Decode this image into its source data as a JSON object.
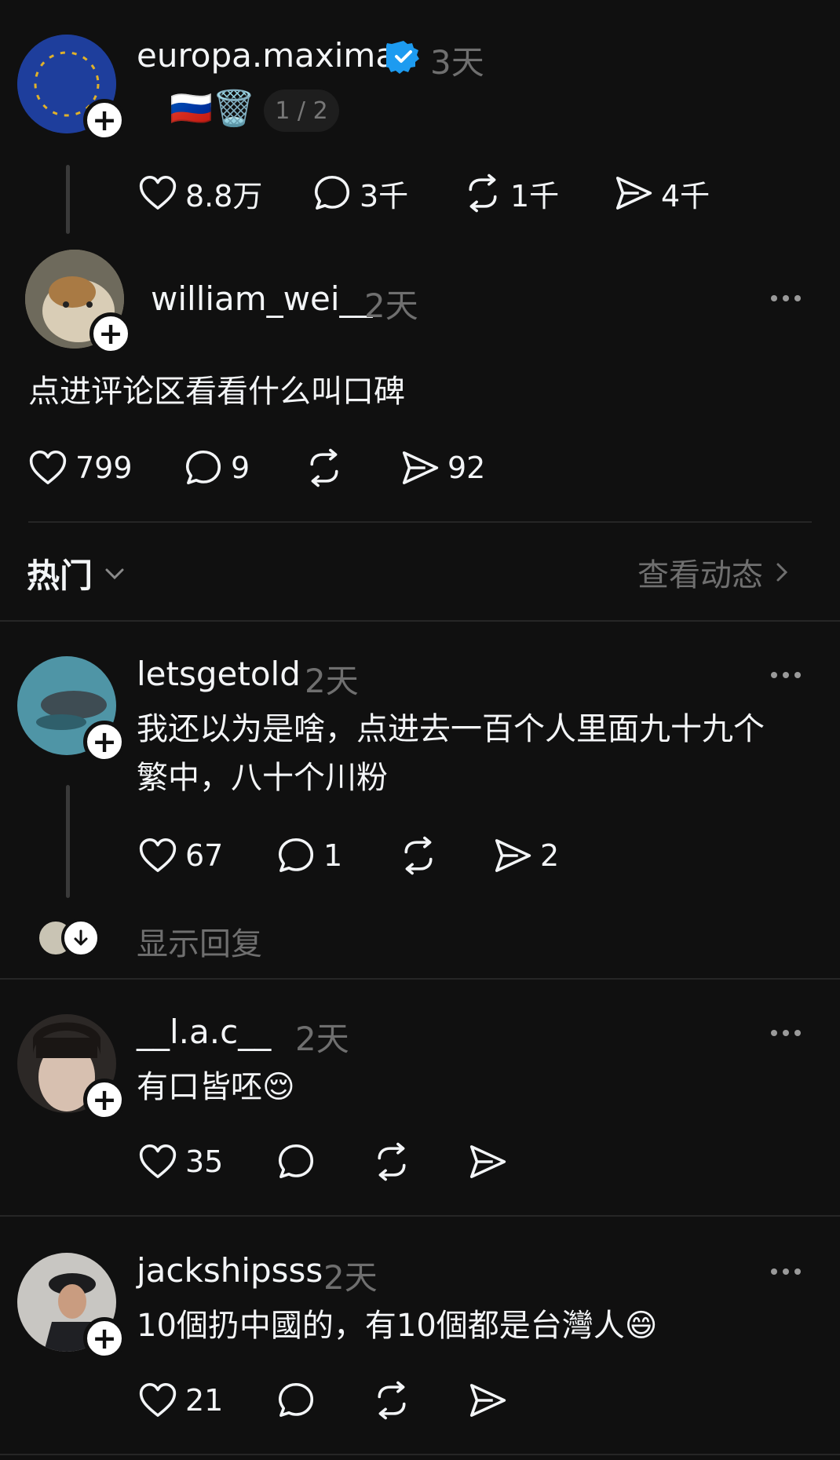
{
  "colors": {
    "background": "#101010",
    "text": "#f3f5f7",
    "muted": "#6f6f6f",
    "verified": "#1d9bf0"
  },
  "op": {
    "username": "europa.maxima",
    "time": "3天",
    "emoji": "🇷🇺🗑️",
    "page_indicator": "1 / 2",
    "likes": "8.8万",
    "comments": "3千",
    "reposts": "1千",
    "shares": "4千"
  },
  "quoted": {
    "username": "william_wei__",
    "time": "2天",
    "text": "点进评论区看看什么叫口碑",
    "likes": "799",
    "comments": "9",
    "shares": "92"
  },
  "sort_bar": {
    "label": "热门",
    "view_activity": "查看动态"
  },
  "replies": [
    {
      "username": "letsgetold",
      "time": "2天",
      "text_line1": "我还以为是啥，点进去一百个人里面九十九个",
      "text_line2": "繁中，八十个川粉",
      "likes": "67",
      "comments": "1",
      "shares": "2",
      "show_replies": "显示回复"
    },
    {
      "username": "__l.a.c__",
      "time": "2天",
      "text": "有口皆呸😌",
      "likes": "35"
    },
    {
      "username": "jackshipsss",
      "time": "2天",
      "text": "10個扔中國的，有10個都是台灣人😄",
      "likes": "21"
    }
  ]
}
